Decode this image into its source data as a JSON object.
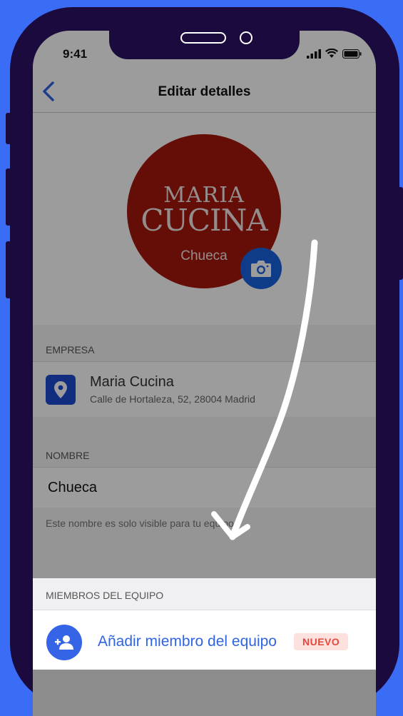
{
  "status_bar": {
    "time": "9:41"
  },
  "nav": {
    "title": "Editar detalles"
  },
  "avatar": {
    "brand_line1": "MARIA",
    "brand_line2": "CUCINA",
    "subtitle": "Chueca"
  },
  "empresa": {
    "label": "EMPRESA",
    "name": "Maria Cucina",
    "address": "Calle de Hortaleza, 52, 28004 Madrid"
  },
  "nombre": {
    "label": "NOMBRE",
    "value": "Chueca",
    "hint": "Este nombre es solo visible para tu equipo."
  },
  "team": {
    "label": "MIEMBROS DEL EQUIPO",
    "add_label": "Añadir miembro del equipo",
    "badge": "NUEVO"
  },
  "colors": {
    "background": "#3b6cf6",
    "frame": "#1a0a3d",
    "avatar": "#a4180c",
    "accent": "#2f64e2",
    "badge_text": "#e2493c",
    "badge_bg": "#fde1de"
  },
  "icons": [
    "back-chevron-icon",
    "signal-icon",
    "wifi-icon",
    "battery-icon",
    "camera-icon",
    "location-pin-icon",
    "add-person-icon",
    "arrow-annotation"
  ]
}
